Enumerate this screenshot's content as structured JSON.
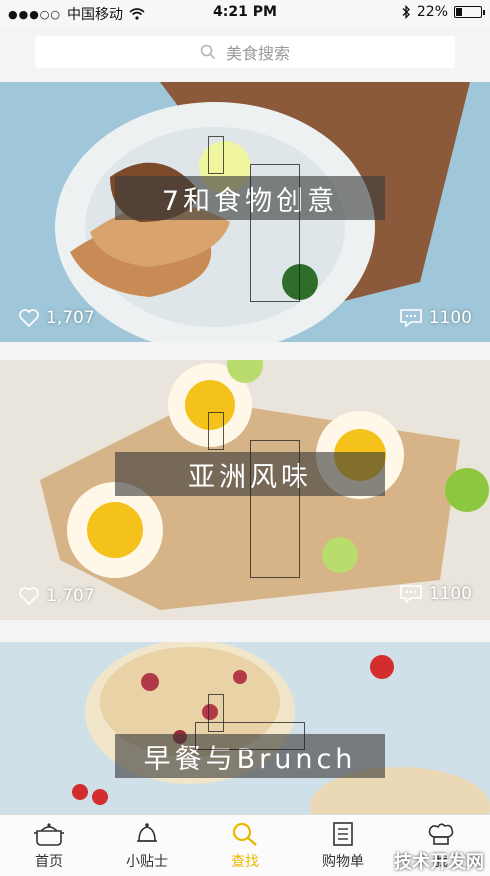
{
  "status_bar": {
    "carrier": "中国移动",
    "time": "4:21 PM",
    "battery": "22%",
    "battery_level": 0.22
  },
  "search": {
    "placeholder": "美食搜索"
  },
  "cards": [
    {
      "title": "7和食物创意",
      "likes": "1,707",
      "comments": "1100"
    },
    {
      "title": "亚洲风味",
      "likes": "1,707",
      "comments": "1100"
    },
    {
      "title": "早餐与Brunch"
    }
  ],
  "tabs": [
    {
      "label": "首页",
      "icon": "pot-icon"
    },
    {
      "label": "小贴士",
      "icon": "bell-icon"
    },
    {
      "label": "查找",
      "icon": "search-icon"
    },
    {
      "label": "购物单",
      "icon": "list-icon"
    },
    {
      "label": "我",
      "icon": "chef-hat-icon"
    }
  ],
  "watermark": "技术开发网",
  "colors": {
    "accent": "#e8b900"
  }
}
